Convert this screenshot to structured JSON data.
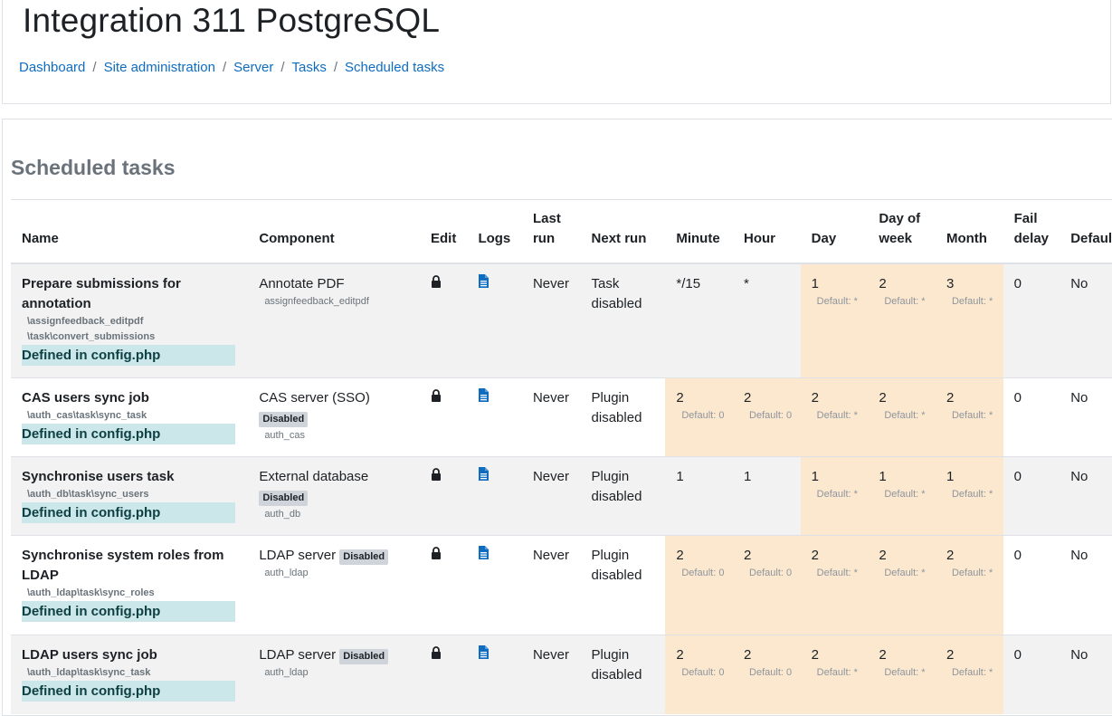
{
  "site": {
    "title": "Integration 311 PostgreSQL"
  },
  "breadcrumb": [
    "Dashboard",
    "Site administration",
    "Server",
    "Tasks",
    "Scheduled tasks"
  ],
  "page": {
    "heading": "Scheduled tasks"
  },
  "table": {
    "columns": [
      "Name",
      "Component",
      "Edit",
      "Logs",
      "Last run",
      "Next run",
      "Minute",
      "Hour",
      "Day",
      "Day of week",
      "Month",
      "Fail delay",
      "Default"
    ],
    "rows": [
      {
        "name": "Prepare submissions for annotation",
        "class_lines": [
          "\\assignfeedback_editpdf",
          "\\task\\convert_submissions"
        ],
        "defined": "Defined in config.php",
        "component": "Annotate PDF",
        "component_badge": "",
        "component_sub": "assignfeedback_editpdf",
        "last_run": "Never",
        "next_run": "Task disabled",
        "minute": "*/15",
        "minute_default": "",
        "hour": "*",
        "hour_default": "",
        "day": "1",
        "day_default": "Default: *",
        "dow": "2",
        "dow_default": "Default: *",
        "month": "3",
        "month_default": "Default: *",
        "fail_delay": "0",
        "default": "No"
      },
      {
        "name": "CAS users sync job",
        "class_lines": [
          "\\auth_cas\\task\\sync_task"
        ],
        "defined": "Defined in config.php",
        "component": "CAS server (SSO)",
        "component_badge": "Disabled",
        "component_sub": "auth_cas",
        "last_run": "Never",
        "next_run": "Plugin disabled",
        "minute": "2",
        "minute_default": "Default: 0",
        "hour": "2",
        "hour_default": "Default: 0",
        "day": "2",
        "day_default": "Default: *",
        "dow": "2",
        "dow_default": "Default: *",
        "month": "2",
        "month_default": "Default: *",
        "fail_delay": "0",
        "default": "No"
      },
      {
        "name": "Synchronise users task",
        "class_lines": [
          "\\auth_db\\task\\sync_users"
        ],
        "defined": "Defined in config.php",
        "component": "External database",
        "component_badge": "Disabled",
        "component_sub": "auth_db",
        "last_run": "Never",
        "next_run": "Plugin disabled",
        "minute": "1",
        "minute_default": "",
        "hour": "1",
        "hour_default": "",
        "day": "1",
        "day_default": "Default: *",
        "dow": "1",
        "dow_default": "Default: *",
        "month": "1",
        "month_default": "Default: *",
        "fail_delay": "0",
        "default": "No"
      },
      {
        "name": "Synchronise system roles from LDAP",
        "class_lines": [
          "\\auth_ldap\\task\\sync_roles"
        ],
        "defined": "Defined in config.php",
        "component": "LDAP server",
        "component_badge": "Disabled",
        "component_sub": "auth_ldap",
        "last_run": "Never",
        "next_run": "Plugin disabled",
        "minute": "2",
        "minute_default": "Default: 0",
        "hour": "2",
        "hour_default": "Default: 0",
        "day": "2",
        "day_default": "Default: *",
        "dow": "2",
        "dow_default": "Default: *",
        "month": "2",
        "month_default": "Default: *",
        "fail_delay": "0",
        "default": "No"
      },
      {
        "name": "LDAP users sync job",
        "class_lines": [
          "\\auth_ldap\\task\\sync_task"
        ],
        "defined": "Defined in config.php",
        "component": "LDAP server",
        "component_badge": "Disabled",
        "component_sub": "auth_ldap",
        "last_run": "Never",
        "next_run": "Plugin disabled",
        "minute": "2",
        "minute_default": "Default: 0",
        "hour": "2",
        "hour_default": "Default: 0",
        "day": "2",
        "day_default": "Default: *",
        "dow": "2",
        "dow_default": "Default: *",
        "month": "2",
        "month_default": "Default: *",
        "fail_delay": "0",
        "default": "No"
      }
    ]
  },
  "icons": {
    "edit": "lock-icon",
    "logs": "log-file-icon"
  },
  "colors": {
    "link": "#0f6cbf",
    "customised": "#fbe8ce",
    "defined_bg": "#cbe7ea",
    "badge_bg": "#ced4da"
  }
}
